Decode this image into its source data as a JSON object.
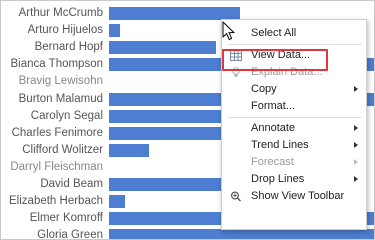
{
  "view": {
    "rows": [
      {
        "name": "Arthur McCrumb",
        "value": 0.49
      },
      {
        "name": "Arturo Hijuelos",
        "value": 0.04
      },
      {
        "name": "Bernard Hopf",
        "value": 0.4
      },
      {
        "name": "Bianca Thompson",
        "value": 1.0
      },
      {
        "name": "Bravig Lewisohn",
        "value": 0
      },
      {
        "name": "Burton Malamud",
        "value": 1.0
      },
      {
        "name": "Carolyn Segal",
        "value": 0.55
      },
      {
        "name": "Charles Fenimore",
        "value": 0.64
      },
      {
        "name": "Clifford Wolitzer",
        "value": 0.15
      },
      {
        "name": "Darryl Fleischman",
        "value": 0
      },
      {
        "name": "David Beam",
        "value": 0.68
      },
      {
        "name": "Elizabeth Herbach",
        "value": 0.06
      },
      {
        "name": "Elmer Komroff",
        "value": 1.0
      },
      {
        "name": "Gloria Green",
        "value": 1.0
      }
    ],
    "bar_color": "#4e7ed1"
  },
  "context_menu": {
    "items": [
      {
        "label": "Select All",
        "icon": null,
        "submenu": false,
        "disabled": false
      },
      {
        "separator": true
      },
      {
        "label": "View Data...",
        "icon": "table-icon",
        "submenu": false,
        "disabled": false,
        "highlighted": true
      },
      {
        "label": "Explain Data...",
        "icon": "lightbulb-icon",
        "submenu": false,
        "disabled": true
      },
      {
        "label": "Copy",
        "icon": null,
        "submenu": true,
        "disabled": false
      },
      {
        "label": "Format...",
        "icon": null,
        "submenu": false,
        "disabled": false
      },
      {
        "separator": true
      },
      {
        "label": "Annotate",
        "icon": null,
        "submenu": true,
        "disabled": false
      },
      {
        "label": "Trend Lines",
        "icon": null,
        "submenu": true,
        "disabled": false
      },
      {
        "label": "Forecast",
        "icon": null,
        "submenu": true,
        "disabled": true
      },
      {
        "label": "Drop Lines",
        "icon": null,
        "submenu": true,
        "disabled": false
      },
      {
        "label": "Show View Toolbar",
        "icon": "zoom-icon",
        "submenu": false,
        "disabled": false
      }
    ],
    "highlight_color": "#e0373e"
  }
}
